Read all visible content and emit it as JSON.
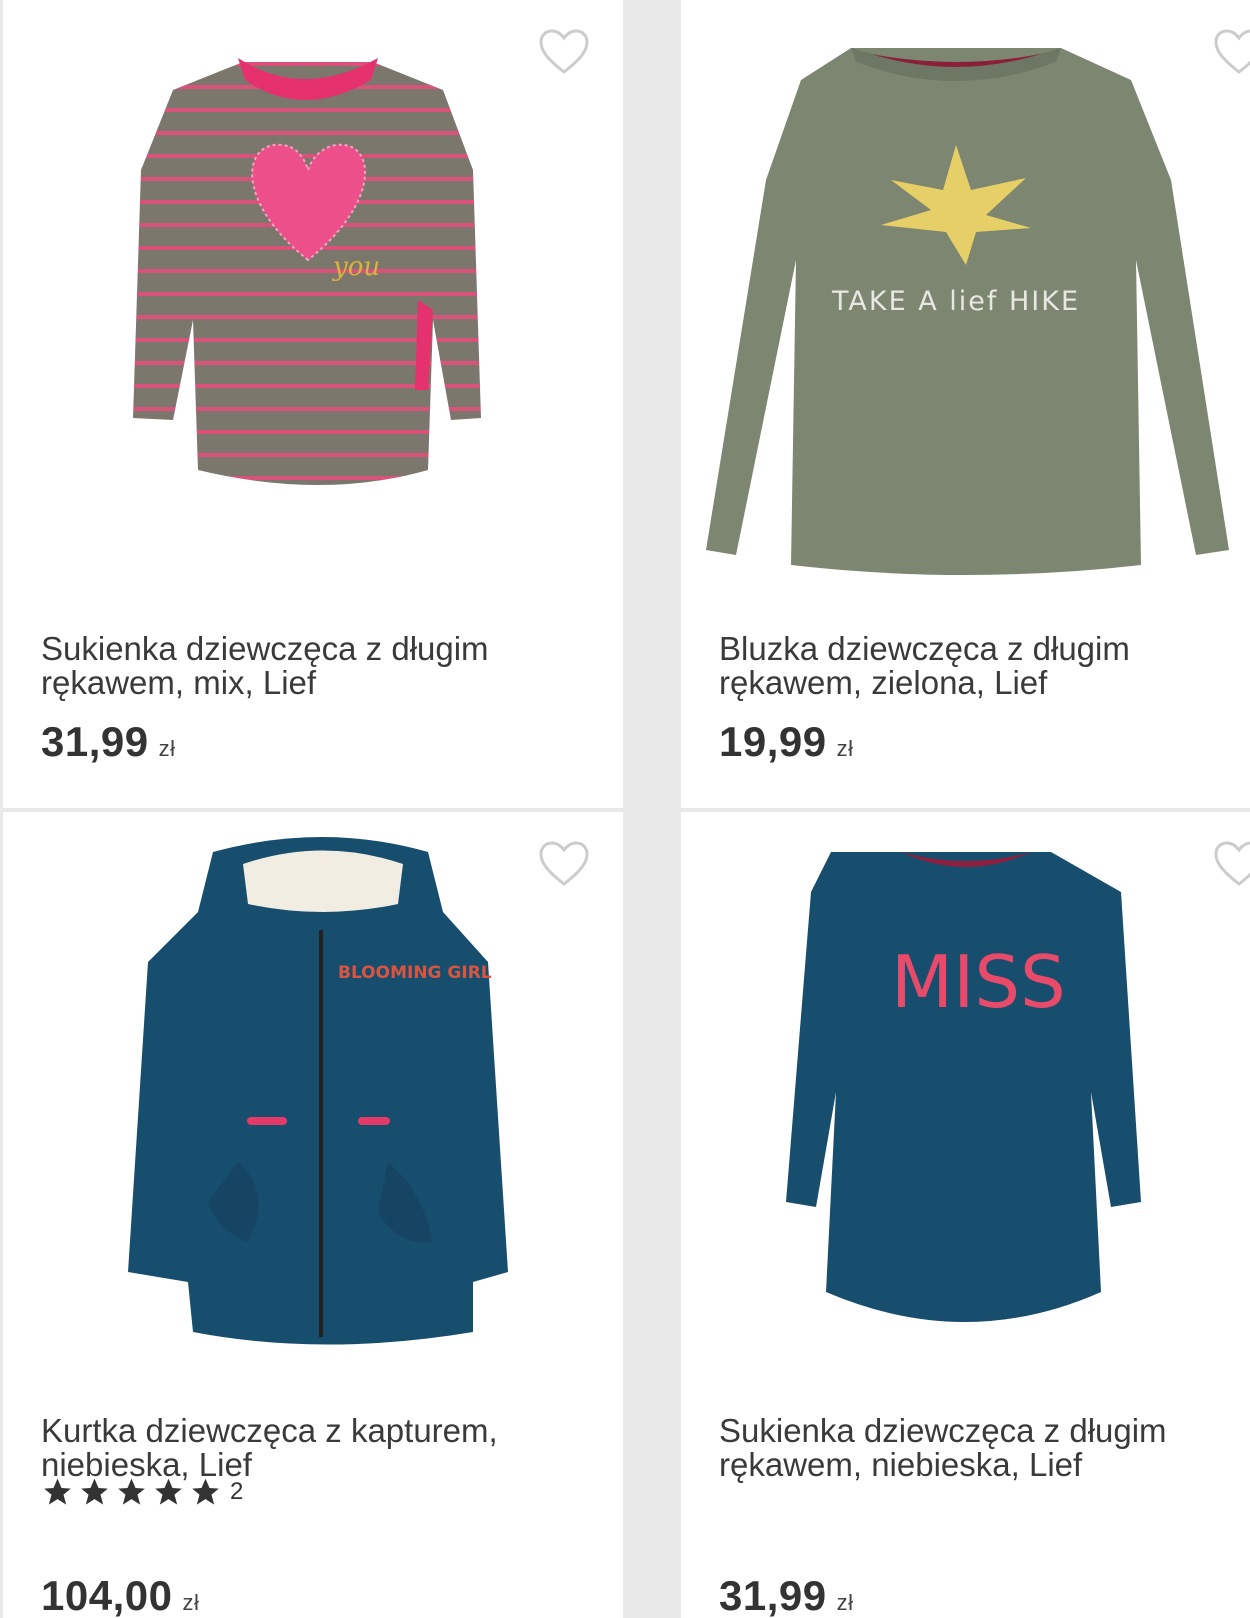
{
  "products": [
    {
      "name_line1": "Sukienka dziewczęca z długim",
      "name_line2": "rękawem, mix, Lief",
      "price": "31,99",
      "currency": "zł",
      "print_text": "you"
    },
    {
      "name_line1": "Bluzka dziewczęca z długim",
      "name_line2": "rękawem, zielona, Lief",
      "price": "19,99",
      "currency": "zł",
      "print_text": "TAKE A lief HIKE"
    },
    {
      "name_line1": "Kurtka dziewczęca z kapturem,",
      "name_line2": "niebieska, Lief",
      "price": "104,00",
      "currency": "zł",
      "rating_count": "2",
      "print_text": "BLOOMING GIRL"
    },
    {
      "name_line1": "Sukienka dziewczęca z długim",
      "name_line2": "rękawem, niebieska, Lief",
      "price": "31,99",
      "currency": "zł",
      "print_text": "MISS"
    }
  ],
  "colors": {
    "price": "#333333",
    "heart_outline": "#cccccc",
    "star": "#333333"
  }
}
